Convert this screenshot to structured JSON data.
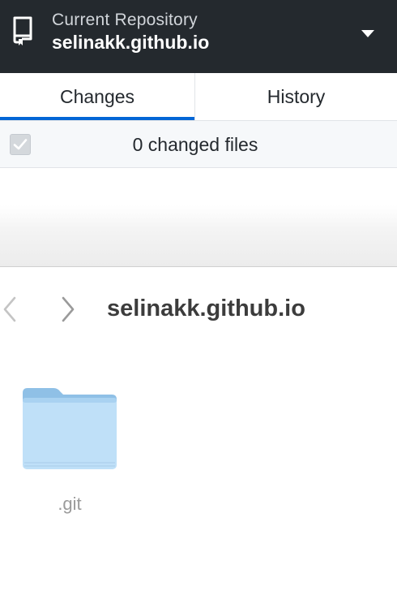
{
  "repository": {
    "caption": "Current Repository",
    "name": "selinakk.github.io",
    "icon": "repo-icon",
    "caret_icon": "chevron-down-icon"
  },
  "tabs": [
    {
      "label": "Changes",
      "selected": true
    },
    {
      "label": "History",
      "selected": false
    }
  ],
  "changes": {
    "count_label": "0 changed files",
    "select_all_checked": true
  },
  "finder": {
    "title": "selinakk.github.io",
    "back_icon": "chevron-left-icon",
    "forward_icon": "chevron-right-icon",
    "items": [
      {
        "name": ".git",
        "icon": "folder-icon"
      }
    ]
  },
  "colors": {
    "header_bg": "#24292e",
    "accent": "#0366d6",
    "folder": "#bfe0f8"
  }
}
